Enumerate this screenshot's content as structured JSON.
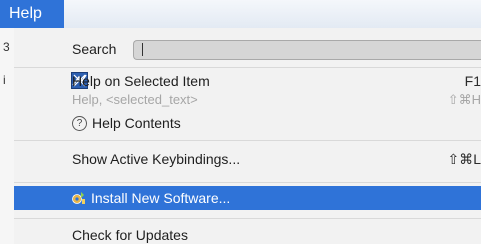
{
  "menubar": {
    "help_label": "Help"
  },
  "gutter": {
    "marks": [
      "3",
      "i"
    ]
  },
  "menu": {
    "search": {
      "label": "Search",
      "value": ""
    },
    "help_on_selected": {
      "label": "Help on Selected Item",
      "shortcut": "F1"
    },
    "help_selected_text": {
      "label": "Help, <selected_text>",
      "shortcut": "⇧⌘H"
    },
    "help_contents": {
      "label": "Help Contents"
    },
    "show_keybindings": {
      "label": "Show Active Keybindings...",
      "shortcut": "⇧⌘L"
    },
    "install_new_software": {
      "label": "Install New Software..."
    },
    "check_updates": {
      "label": "Check for Updates"
    }
  },
  "colors": {
    "selection": "#2f73d8",
    "menu_background": "#f2f2f2"
  },
  "icons": [
    "help-on-item-icon",
    "help-contents-icon",
    "install-software-icon"
  ]
}
